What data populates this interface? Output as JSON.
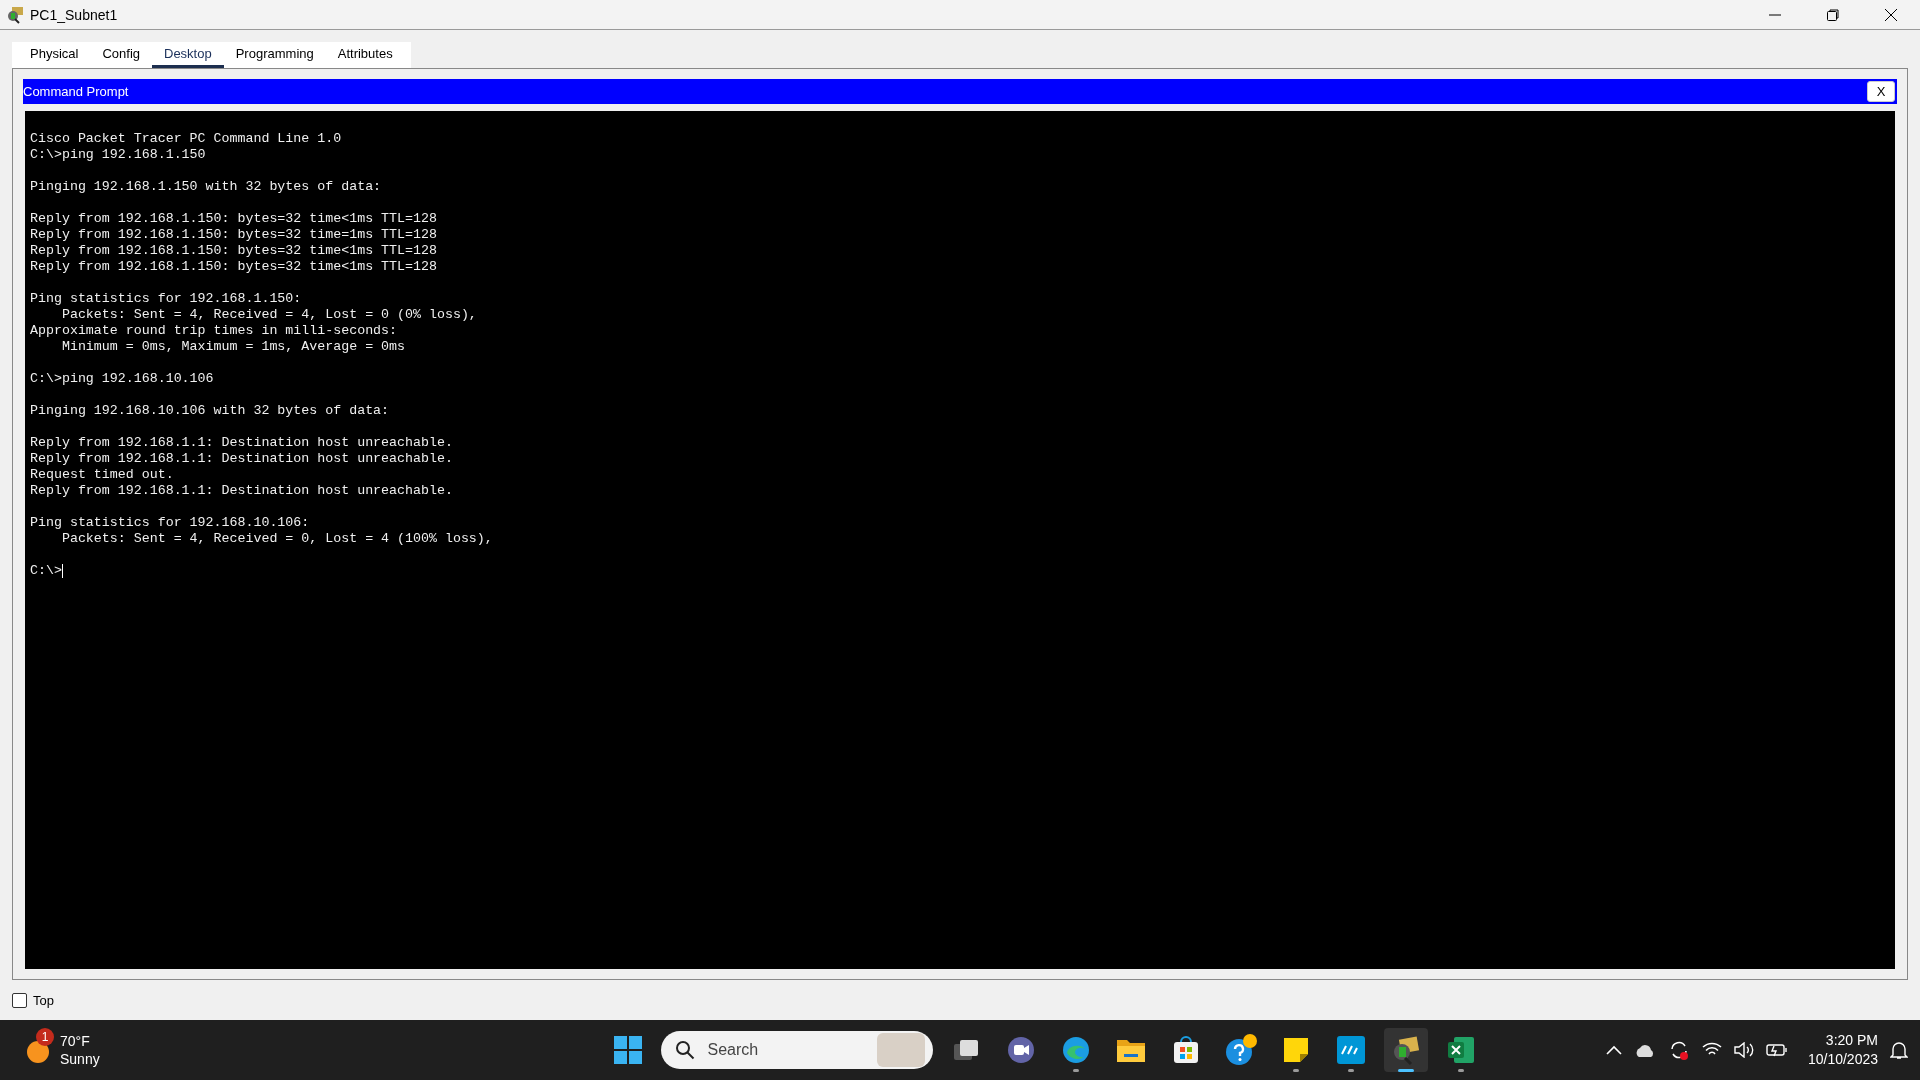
{
  "window": {
    "title": "PC1_Subnet1"
  },
  "tabs": [
    {
      "label": "Physical",
      "selected": false
    },
    {
      "label": "Config",
      "selected": false
    },
    {
      "label": "Desktop",
      "selected": true
    },
    {
      "label": "Programming",
      "selected": false
    },
    {
      "label": "Attributes",
      "selected": false
    }
  ],
  "app": {
    "title": "Command Prompt",
    "close_label": "X"
  },
  "terminal": {
    "blocks": [
      [
        "Cisco Packet Tracer PC Command Line 1.0",
        "C:\\>ping 192.168.1.150"
      ],
      [
        "Pinging 192.168.1.150 with 32 bytes of data:"
      ],
      [
        "Reply from 192.168.1.150: bytes=32 time<1ms TTL=128",
        "Reply from 192.168.1.150: bytes=32 time=1ms TTL=128",
        "Reply from 192.168.1.150: bytes=32 time<1ms TTL=128",
        "Reply from 192.168.1.150: bytes=32 time<1ms TTL=128"
      ],
      [
        "Ping statistics for 192.168.1.150:",
        "    Packets: Sent = 4, Received = 4, Lost = 0 (0% loss),",
        "Approximate round trip times in milli-seconds:",
        "    Minimum = 0ms, Maximum = 1ms, Average = 0ms"
      ],
      [
        "C:\\>ping 192.168.10.106"
      ],
      [
        "Pinging 192.168.10.106 with 32 bytes of data:"
      ],
      [
        "Reply from 192.168.1.1: Destination host unreachable.",
        "Reply from 192.168.1.1: Destination host unreachable.",
        "Request timed out.",
        "Reply from 192.168.1.1: Destination host unreachable."
      ],
      [
        "Ping statistics for 192.168.10.106:",
        "    Packets: Sent = 4, Received = 0, Lost = 4 (100% loss),"
      ]
    ],
    "prompt": "C:\\>"
  },
  "top_checkbox": {
    "label": "Top",
    "checked": false
  },
  "taskbar": {
    "weather": {
      "badge": "1",
      "temperature": "70°F",
      "condition": "Sunny"
    },
    "search": {
      "placeholder": "Search"
    },
    "apps": [
      {
        "kind": "taskview",
        "running": false,
        "selected": false
      },
      {
        "kind": "chat",
        "running": false,
        "selected": false
      },
      {
        "kind": "browser",
        "running": true,
        "selected": false
      },
      {
        "kind": "folder",
        "running": false,
        "selected": false
      },
      {
        "kind": "store",
        "running": false,
        "selected": false
      },
      {
        "kind": "help",
        "running": false,
        "selected": false
      },
      {
        "kind": "notes",
        "running": true,
        "selected": false
      },
      {
        "kind": "hp",
        "running": true,
        "selected": false
      },
      {
        "kind": "tracer",
        "running": true,
        "selected": true
      },
      {
        "kind": "excel",
        "running": true,
        "selected": false
      }
    ],
    "time": "3:20 PM",
    "date": "10/10/2023"
  }
}
